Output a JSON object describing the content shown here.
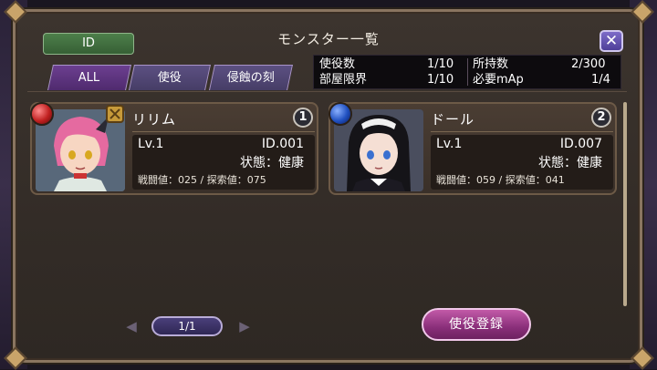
{
  "header": {
    "title": "モンスター一覧",
    "id_button": "ID",
    "close_icon": "close-x-icon"
  },
  "tabs": [
    {
      "label": "ALL",
      "active": true
    },
    {
      "label": "使役",
      "active": false
    },
    {
      "label": "侵蝕の刻",
      "active": false
    }
  ],
  "stats": {
    "row1_left_label": "使役数",
    "row1_left_value": "1/10",
    "row1_right_label": "所持数",
    "row1_right_value": "2/300",
    "row2_left_label": "部屋限界",
    "row2_left_value": "1/10",
    "row2_right_label": "必要mAp",
    "row2_right_value": "1/4"
  },
  "monsters": [
    {
      "name": "リリム",
      "slot": "1",
      "level": "Lv.1",
      "id": "ID.001",
      "state": "状態：健康",
      "stats_line": "戦闘値：025 / 探索値：075",
      "orb_color": "#c02020",
      "portrait_icon": "pink-haired-girl-portrait"
    },
    {
      "name": "ドール",
      "slot": "2",
      "level": "Lv.1",
      "id": "ID.007",
      "state": "状態：健康",
      "stats_line": "戦闘値：059 / 探索値：041",
      "orb_color": "#2050c0",
      "portrait_icon": "maid-girl-portrait"
    }
  ],
  "pager": {
    "label": "1/1",
    "prev_icon": "arrow-left-icon",
    "next_icon": "arrow-right-icon"
  },
  "register_button": "使役登録"
}
